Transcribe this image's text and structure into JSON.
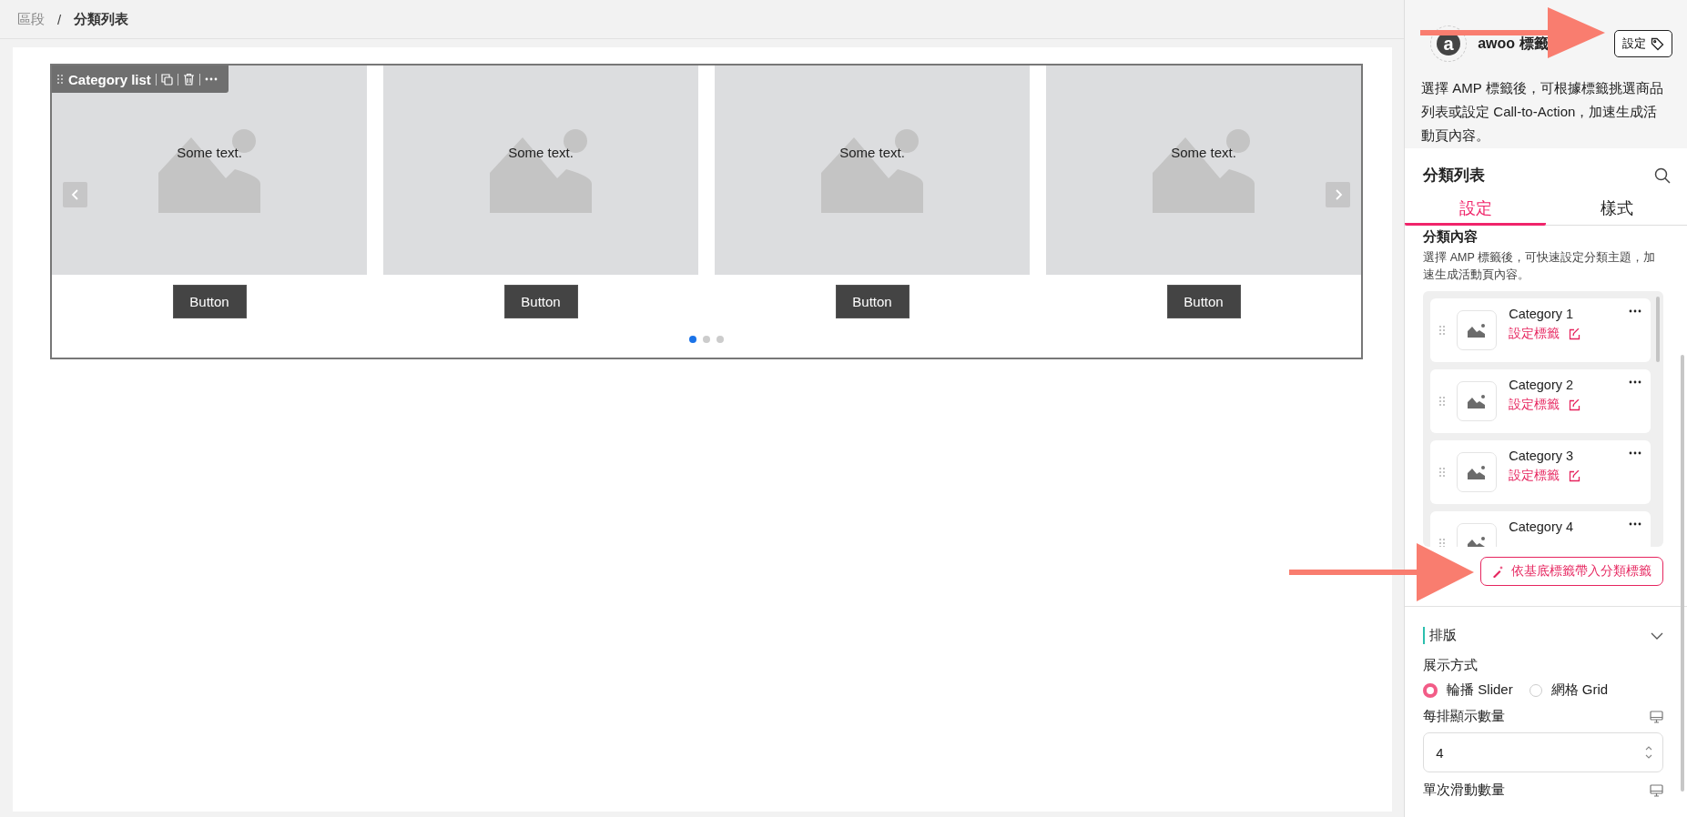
{
  "breadcrumb": {
    "items": [
      "區段",
      "分類列表"
    ],
    "separator": "/"
  },
  "block_toolbar": {
    "title": "Category list"
  },
  "slides": [
    {
      "caption": "Some text.",
      "button": "Button"
    },
    {
      "caption": "Some text.",
      "button": "Button"
    },
    {
      "caption": "Some text.",
      "button": "Button"
    },
    {
      "caption": "Some text.",
      "button": "Button"
    }
  ],
  "dots": [
    {
      "selected": true
    },
    {
      "selected": false
    },
    {
      "selected": false
    }
  ],
  "panel": {
    "brand": {
      "logo_letter": "a",
      "name": "awoo 標籤",
      "button": "設定"
    },
    "description": "選擇 AMP 標籤後，可根據標籤挑選商品列表或設定 Call-to-Action，加速生成活動頁內容。",
    "title": "分類列表",
    "tabs": [
      {
        "label": "設定",
        "selected": true
      },
      {
        "label": "樣式",
        "selected": false
      }
    ],
    "section": {
      "title": "分類內容",
      "description": "選擇 AMP 標籤後，可快速設定分類主題，加速生成活動頁內容。"
    },
    "categories": [
      {
        "name": "Category 1",
        "link": "設定標籤"
      },
      {
        "name": "Category 2",
        "link": "設定標籤"
      },
      {
        "name": "Category 3",
        "link": "設定標籤"
      },
      {
        "name": "Category 4"
      }
    ],
    "import_button": "依基底標籤帶入分類標籤",
    "layout": {
      "title": "排版",
      "expanded": true,
      "display_label": "展示方式",
      "options": [
        {
          "label": "輪播 Slider",
          "selected": true
        },
        {
          "label": "網格 Grid",
          "selected": false
        }
      ],
      "per_row": {
        "label": "每排顯示數量",
        "value": "4"
      },
      "per_slide": {
        "label": "單次滑動數量"
      }
    }
  }
}
